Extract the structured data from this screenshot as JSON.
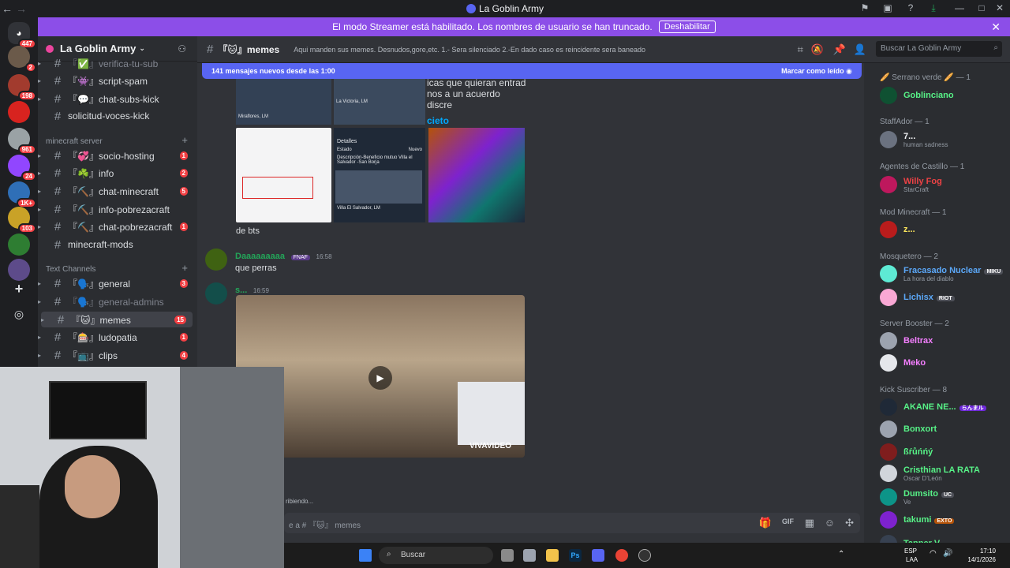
{
  "window": {
    "title": "La Goblin Army"
  },
  "banner": {
    "text": "El modo Streamer está habilitado. Los nombres de usuario se han truncado.",
    "button": "Deshabilitar"
  },
  "servers": [
    {
      "badge": "447"
    },
    {
      "badge": "2"
    },
    {
      "badge": "198"
    },
    {
      "badge": ""
    },
    {
      "badge": "961"
    },
    {
      "badge": "24"
    },
    {
      "badge": "1K+"
    },
    {
      "badge": "103"
    },
    {
      "badge": ""
    },
    {
      "badge": ""
    }
  ],
  "guild": {
    "name": "La Goblin Army"
  },
  "channels": {
    "top": [
      {
        "name": "『✅』verifica-tu-sub",
        "unread": ""
      },
      {
        "name": "『👾』script-spam",
        "unread": ""
      },
      {
        "name": "『💬』chat-subs-kick",
        "unread": ""
      },
      {
        "name": "solicitud-voces-kick",
        "unread": ""
      }
    ],
    "cat_minecraft": "minecraft server",
    "minecraft": [
      {
        "name": "『💞』socio-hosting",
        "unread": "1"
      },
      {
        "name": "『☘️』info",
        "unread": "2"
      },
      {
        "name": "『⛏️』chat-minecraft",
        "unread": "5"
      },
      {
        "name": "『⛏️』info-pobrezacraft",
        "unread": ""
      },
      {
        "name": "『⛏️』chat-pobrezacraft",
        "unread": "1"
      },
      {
        "name": "minecraft-mods",
        "unread": ""
      }
    ],
    "cat_text": "Text Channels",
    "text": [
      {
        "name": "『🗣️』general",
        "unread": "3"
      },
      {
        "name": "『🗣️』general-admins",
        "unread": ""
      },
      {
        "name": "『🐱』memes",
        "unread": "15"
      },
      {
        "name": "『🎰』ludopatia",
        "unread": "1"
      },
      {
        "name": "『📺』clips",
        "unread": "4"
      }
    ]
  },
  "header": {
    "channel": "『🐱』memes",
    "topic": "Aqui manden sus memes. Desnudos,gore,etc. 1.- Sera silenciado 2.-En dado caso es reincidente sera baneado",
    "search_placeholder": "Buscar La Goblin Army"
  },
  "new_messages": {
    "text": "141 mensajes nuevos desde las 1:00",
    "mark_read": "Marcar como leído"
  },
  "messages": [
    {
      "text": "de bts"
    },
    {
      "author": "Daaaaaaaaa",
      "tag": "FNAF",
      "time": "16:58",
      "text": "que perras"
    },
    {
      "author": "s...",
      "time": "16:59",
      "video_watermark": "VIVAVIDEO"
    }
  ],
  "embed": {
    "map1": "Miraflores, LM",
    "map2": "La Victoria, LM",
    "map3": "Villa El Salvador, LM",
    "detalles": "Detalles",
    "estado_label": "Estado",
    "estado_value": "Nuevo",
    "desc": "Descripción-Beneficio mutuo Villa el Salvador -San Borja",
    "partial1": "icas que quieran entrad",
    "partial2": "nos a un acuerdo discre",
    "partial3": "cieto"
  },
  "typing": "ribiendo...",
  "composer": {
    "placeholder": "e a # 『🐱』 memes"
  },
  "members": {
    "groups": [
      {
        "title": "🥖 Serrano verde 🥖 — 1",
        "members": [
          {
            "name": "Goblinciano",
            "color": "#57f287",
            "sub": ""
          }
        ]
      },
      {
        "title": "StaffAdor — 1",
        "members": [
          {
            "name": "7...",
            "color": "#f2f3f5",
            "sub": "human sadness"
          }
        ]
      },
      {
        "title": "Agentes de Castillo — 1",
        "members": [
          {
            "name": "Willy Fog",
            "color": "#ed4245",
            "sub": "StarCraft"
          }
        ]
      },
      {
        "title": "Mod Minecraft — 1",
        "members": [
          {
            "name": "z...",
            "color": "#fee75c",
            "sub": ""
          }
        ]
      },
      {
        "title": "Mosquetero — 2",
        "members": [
          {
            "name": "Fracasado Nuclear",
            "color": "#5ba7f7",
            "sub": "La hora del diablo",
            "tag": "MIKU"
          },
          {
            "name": "Lichisx",
            "color": "#5ba7f7",
            "sub": "",
            "tag": "RIOT"
          }
        ]
      },
      {
        "title": "Server Booster — 2",
        "members": [
          {
            "name": "Beltrax",
            "color": "#f47fff",
            "sub": ""
          },
          {
            "name": "Meko",
            "color": "#f47fff",
            "sub": ""
          }
        ]
      },
      {
        "title": "Kick Suscriber — 8",
        "members": [
          {
            "name": "AKANE NE...",
            "color": "#57f287",
            "sub": "",
            "tag": "らんまル"
          },
          {
            "name": "Bonxort",
            "color": "#57f287",
            "sub": ""
          },
          {
            "name": "ßŕůńńý",
            "color": "#57f287",
            "sub": ""
          },
          {
            "name": "Cristhian LA RATA",
            "color": "#57f287",
            "sub": "Oscar D'León"
          },
          {
            "name": "Dumsito",
            "color": "#57f287",
            "sub": "Ve",
            "tag": "UC"
          },
          {
            "name": "takumi",
            "color": "#57f287",
            "sub": "",
            "tag": "EXTO"
          },
          {
            "name": "Tanner V",
            "color": "#57f287",
            "sub": ""
          }
        ]
      }
    ]
  },
  "taskbar": {
    "search": "Buscar",
    "lang1": "ESP",
    "lang2": "LAA",
    "time": "17:10",
    "date": "14/1/2026"
  }
}
